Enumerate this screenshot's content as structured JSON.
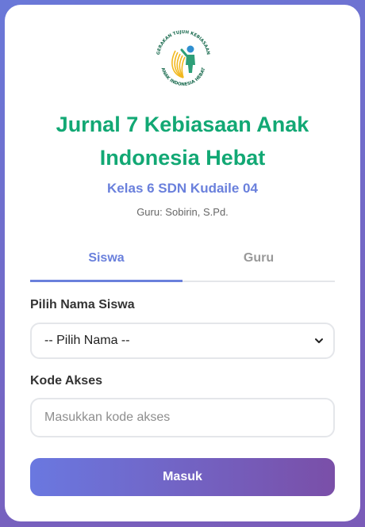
{
  "logo": {
    "icon": "seven-habits-logo-icon",
    "text_top": "GERAKAN TUJUH KEBIASAAN",
    "text_bottom": "ANAK INDONESIA HEBAT"
  },
  "header": {
    "title": "Jurnal 7 Kebiasaan Anak Indonesia Hebat",
    "subtitle": "Kelas 6 SDN Kudaile 04",
    "teacher": "Guru: Sobirin, S.Pd."
  },
  "tabs": [
    {
      "label": "Siswa",
      "active": true
    },
    {
      "label": "Guru",
      "active": false
    }
  ],
  "form": {
    "student_label": "Pilih Nama Siswa",
    "student_select_value": "-- Pilih Nama --",
    "code_label": "Kode Akses",
    "code_placeholder": "Masukkan kode akses",
    "code_value": ""
  },
  "submit_label": "Masuk",
  "colors": {
    "title": "#12a874",
    "accent": "#6a80dc",
    "button_start": "#6a78e0",
    "button_end": "#7a4fa8",
    "logo_yellow": "#f2b81f",
    "logo_green": "#2e9f78",
    "logo_blue": "#2f8fd0"
  }
}
